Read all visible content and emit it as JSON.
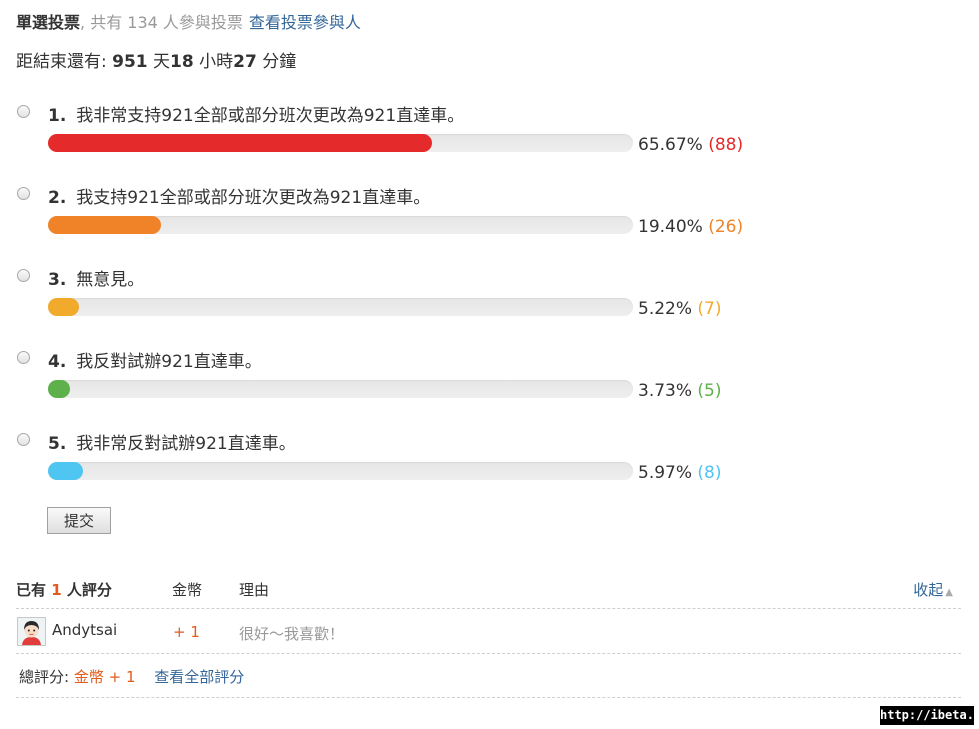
{
  "poll": {
    "type_label": "單選投票",
    "voter_count_text": ", 共有 134 人參與投票",
    "view_voters_link": "查看投票參與人",
    "countdown": {
      "prefix": "距結束還有:",
      "days": "951",
      "days_unit": "天",
      "hours": "18",
      "hours_unit": "小時",
      "minutes": "27",
      "minutes_unit": "分鐘"
    },
    "options": [
      {
        "index": "1.",
        "label": "我非常支持921全部或部分班次更改為921直達車。",
        "percent_text": "65.67%",
        "votes_text": "(88)",
        "percent": 65.67,
        "color": "#e42a2a"
      },
      {
        "index": "2.",
        "label": "我支持921全部或部分班次更改為921直達車。",
        "percent_text": "19.40%",
        "votes_text": "(26)",
        "percent": 19.4,
        "color": "#f08327"
      },
      {
        "index": "3.",
        "label": "無意見。",
        "percent_text": "5.22%",
        "votes_text": "(7)",
        "percent": 5.22,
        "color": "#f1aa2b"
      },
      {
        "index": "4.",
        "label": "我反對試辦921直達車。",
        "percent_text": "3.73%",
        "votes_text": "(5)",
        "percent": 3.73,
        "color": "#5eb04b"
      },
      {
        "index": "5.",
        "label": "我非常反對試辦921直達車。",
        "percent_text": "5.97%",
        "votes_text": "(8)",
        "percent": 5.97,
        "color": "#4fc5f1"
      }
    ],
    "submit_label": "提交"
  },
  "rating": {
    "header": {
      "prefix": "已有",
      "count": "1",
      "suffix": "人評分",
      "coin_col": "金幣",
      "reason_col": "理由",
      "collapse_label": "收起"
    },
    "rows": [
      {
        "user": "Andytsai",
        "coin": "+ 1",
        "reason": "很好～我喜歡！"
      }
    ],
    "total": {
      "label": "總評分:",
      "value": "金幣 + 1",
      "view_all_link": "查看全部評分"
    }
  },
  "watermark": "http://ibeta.tw"
}
